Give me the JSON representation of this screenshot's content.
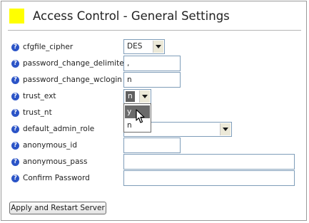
{
  "header": {
    "title": "Access Control - General Settings",
    "accent_color": "#ffff00"
  },
  "help_icon": {
    "glyph": "?",
    "color": "#2b54c7"
  },
  "fields": {
    "cfgfile_cipher": {
      "label": "cfgfile_cipher",
      "value": "DES"
    },
    "password_change_delimiter": {
      "label": "password_change_delimiter",
      "value": ","
    },
    "password_change_wclogin": {
      "label": "password_change_wclogin",
      "value": "n"
    },
    "trust_ext": {
      "label": "trust_ext",
      "value": "n",
      "options": [
        "y",
        "n"
      ],
      "hovered_option": "y"
    },
    "trust_nt": {
      "label": "trust_nt"
    },
    "default_admin_role": {
      "label": "default_admin_role",
      "value": ""
    },
    "anonymous_id": {
      "label": "anonymous_id",
      "value": ""
    },
    "anonymous_pass": {
      "label": "anonymous_pass",
      "value": ""
    },
    "confirm_password": {
      "label": "Confirm Password",
      "value": ""
    }
  },
  "actions": {
    "apply_label": "Apply and Restart Server"
  }
}
